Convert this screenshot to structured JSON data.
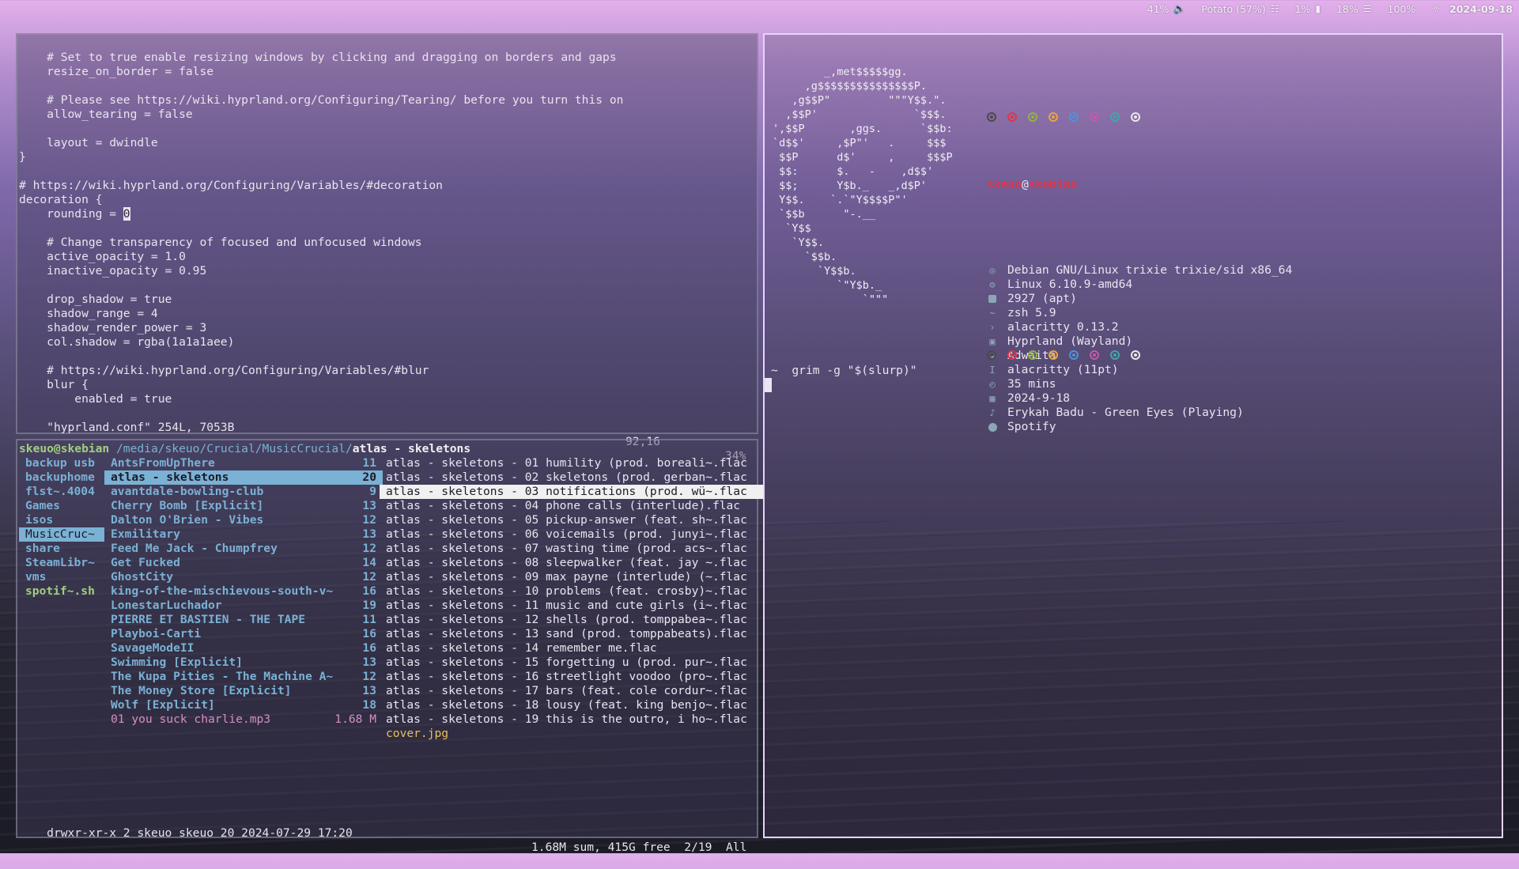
{
  "topbar": {
    "volume": "41%",
    "wifi": "Potato (57%)",
    "battery": "1%",
    "cpu": "18%",
    "brightness": "100%",
    "date": "2024-09-18"
  },
  "vim": {
    "lines": [
      "    # Set to true enable resizing windows by clicking and dragging on borders and gaps",
      "    resize_on_border = false",
      "",
      "    # Please see https://wiki.hyprland.org/Configuring/Tearing/ before you turn this on",
      "    allow_tearing = false",
      "",
      "    layout = dwindle",
      "}",
      "",
      "# https://wiki.hyprland.org/Configuring/Variables/#decoration",
      "decoration {",
      "    rounding = ",
      "",
      "    # Change transparency of focused and unfocused windows",
      "    active_opacity = 1.0",
      "    inactive_opacity = 0.95",
      "",
      "    drop_shadow = true",
      "    shadow_range = 4",
      "    shadow_render_power = 3",
      "    col.shadow = rgba(1a1a1aee)",
      "",
      "    # https://wiki.hyprland.org/Configuring/Variables/#blur",
      "    blur {",
      "        enabled = true"
    ],
    "cursor_char": "0",
    "status_file": "\"hyprland.conf\" 254L, 7053B",
    "status_pos": "92,16",
    "status_pct": "34%"
  },
  "ranger": {
    "user": "skeuo@skebian",
    "dir": " /media/skeuo/Crucial/MusicCrucial/",
    "current": "atlas - skeletons",
    "col1": [
      {
        "name": "backup usb",
        "style": "blue"
      },
      {
        "name": "backuphome",
        "style": "blue"
      },
      {
        "name": "flst~.4004",
        "style": "blue"
      },
      {
        "name": "Games",
        "style": "blue"
      },
      {
        "name": "isos",
        "style": "blue"
      },
      {
        "name": "MusicCruc~",
        "style": "hl"
      },
      {
        "name": "share",
        "style": "blue"
      },
      {
        "name": "SteamLibr~",
        "style": "blue"
      },
      {
        "name": "vms",
        "style": "blue"
      },
      {
        "name": "spotif~.sh",
        "style": "green"
      }
    ],
    "col2": [
      {
        "name": "AntsFromUpThere",
        "count": "11",
        "style": "blue"
      },
      {
        "name": "atlas - skeletons",
        "count": "20",
        "style": "sel"
      },
      {
        "name": "avantdale-bowling-club",
        "count": "9",
        "style": "blue"
      },
      {
        "name": "Cherry Bomb [Explicit]",
        "count": "13",
        "style": "blue"
      },
      {
        "name": "Dalton O'Brien - Vibes",
        "count": "12",
        "style": "blue"
      },
      {
        "name": "Exmilitary",
        "count": "13",
        "style": "blue"
      },
      {
        "name": "Feed Me Jack - Chumpfrey",
        "count": "12",
        "style": "blue"
      },
      {
        "name": "Get Fucked",
        "count": "14",
        "style": "blue"
      },
      {
        "name": "GhostCity",
        "count": "12",
        "style": "blue"
      },
      {
        "name": "king-of-the-mischievous-south-v~",
        "count": "16",
        "style": "blue"
      },
      {
        "name": "LonestarLuchador",
        "count": "19",
        "style": "blue"
      },
      {
        "name": "PIERRE ET BASTIEN - THE TAPE",
        "count": "11",
        "style": "blue"
      },
      {
        "name": "Playboi-Carti",
        "count": "16",
        "style": "blue"
      },
      {
        "name": "SavageModeII",
        "count": "16",
        "style": "blue"
      },
      {
        "name": "Swimming [Explicit]",
        "count": "13",
        "style": "blue"
      },
      {
        "name": "The Kupa Pities - The Machine A~",
        "count": "12",
        "style": "blue"
      },
      {
        "name": "The Money Store [Explicit]",
        "count": "13",
        "style": "blue"
      },
      {
        "name": "Wolf [Explicit]",
        "count": "18",
        "style": "blue"
      },
      {
        "name": "01 you suck charlie.mp3",
        "count": "1.68 M",
        "style": "pink"
      }
    ],
    "col3": [
      {
        "name": "atlas - skeletons - 01 humility (prod. boreali~.flac",
        "style": "plain"
      },
      {
        "name": "atlas - skeletons - 02 skeletons (prod. gerban~.flac",
        "style": "plain"
      },
      {
        "name": "atlas - skeletons - 03 notifications (prod. wü~.flac",
        "style": "sel2"
      },
      {
        "name": "atlas - skeletons - 04 phone calls (interlude).flac",
        "style": "plain"
      },
      {
        "name": "atlas - skeletons - 05 pickup-answer (feat. sh~.flac",
        "style": "plain"
      },
      {
        "name": "atlas - skeletons - 06 voicemails (prod. junyi~.flac",
        "style": "plain"
      },
      {
        "name": "atlas - skeletons - 07 wasting time (prod. acs~.flac",
        "style": "plain"
      },
      {
        "name": "atlas - skeletons - 08 sleepwalker (feat. jay ~.flac",
        "style": "plain"
      },
      {
        "name": "atlas - skeletons - 09 max payne (interlude) (~.flac",
        "style": "plain"
      },
      {
        "name": "atlas - skeletons - 10 problems (feat. crosby)~.flac",
        "style": "plain"
      },
      {
        "name": "atlas - skeletons - 11 music and cute girls (i~.flac",
        "style": "plain"
      },
      {
        "name": "atlas - skeletons - 12 shells (prod. tomppabea~.flac",
        "style": "plain"
      },
      {
        "name": "atlas - skeletons - 13 sand (prod. tomppabeats).flac",
        "style": "plain"
      },
      {
        "name": "atlas - skeletons - 14 remember me.flac",
        "style": "plain"
      },
      {
        "name": "atlas - skeletons - 15 forgetting u (prod. pur~.flac",
        "style": "plain"
      },
      {
        "name": "atlas - skeletons - 16 streetlight voodoo (pro~.flac",
        "style": "plain"
      },
      {
        "name": "atlas - skeletons - 17 bars (feat. cole cordur~.flac",
        "style": "plain"
      },
      {
        "name": "atlas - skeletons - 18 lousy (feat. king benjo~.flac",
        "style": "plain"
      },
      {
        "name": "atlas - skeletons - 19 this is the outro, i ho~.flac",
        "style": "plain"
      },
      {
        "name": "cover.jpg",
        "style": "yellow"
      }
    ],
    "bottom_left": "drwxr-xr-x 2 skeuo skeuo 20 2024-07-29 17:20",
    "bottom_right": "1.68M sum, 415G free  2/19  All"
  },
  "fastfetch": {
    "logo_lines": [
      "        _,met$$$$$gg.",
      "     ,g$$$$$$$$$$$$$$$P.",
      "   ,g$$P\"         \"\"\"Y$$.\".",
      "  ,$$P'               `$$$.",
      "',$$P       ,ggs.      `$$b:",
      "`d$$'     ,$P\"'   .     $$$",
      " $$P      d$'     ,     $$$P",
      " $$:      $.   -    ,d$$'",
      " $$;      Y$b._   _,d$P'",
      " Y$$.    `.`\"Y$$$$P\"'",
      " `$$b      \"-.__",
      "  `Y$$",
      "   `Y$$.",
      "     `$$b.",
      "       `Y$$b.",
      "          `\"Y$b._",
      "              `\"\"\""
    ],
    "user": "skeuo",
    "at": "@",
    "host": "skebian",
    "dot_colors": [
      "#4a4a4a",
      "#e0344a",
      "#8fb43c",
      "#e8a53a",
      "#4d93d8",
      "#c45aa8",
      "#3fa6a8",
      "#e8e8e8"
    ],
    "info": [
      {
        "icon": "debian-icon",
        "value": "Debian GNU/Linux trixie trixie/sid x86_64"
      },
      {
        "icon": "kernel-icon",
        "value": "Linux 6.10.9-amd64"
      },
      {
        "icon": "package-icon",
        "value": "2927 (apt)"
      },
      {
        "icon": "shell-icon",
        "value": "zsh 5.9"
      },
      {
        "icon": "terminal-icon",
        "value": "alacritty 0.13.2"
      },
      {
        "icon": "window-manager-icon",
        "value": "Hyprland (Wayland)"
      },
      {
        "icon": "theme-icon",
        "value": "Adwaita"
      },
      {
        "icon": "font-icon",
        "value": "alacritty (11pt)"
      },
      {
        "icon": "clock-icon",
        "value": "35 mins"
      },
      {
        "icon": "calendar-icon",
        "value": "2024-9-18"
      },
      {
        "icon": "music-icon",
        "value": "Erykah Badu - Green Eyes (Playing)"
      },
      {
        "icon": "player-icon",
        "value": "Spotify"
      }
    ],
    "prompt_symbol": "~",
    "command": "grim -g \"$(slurp)\""
  }
}
